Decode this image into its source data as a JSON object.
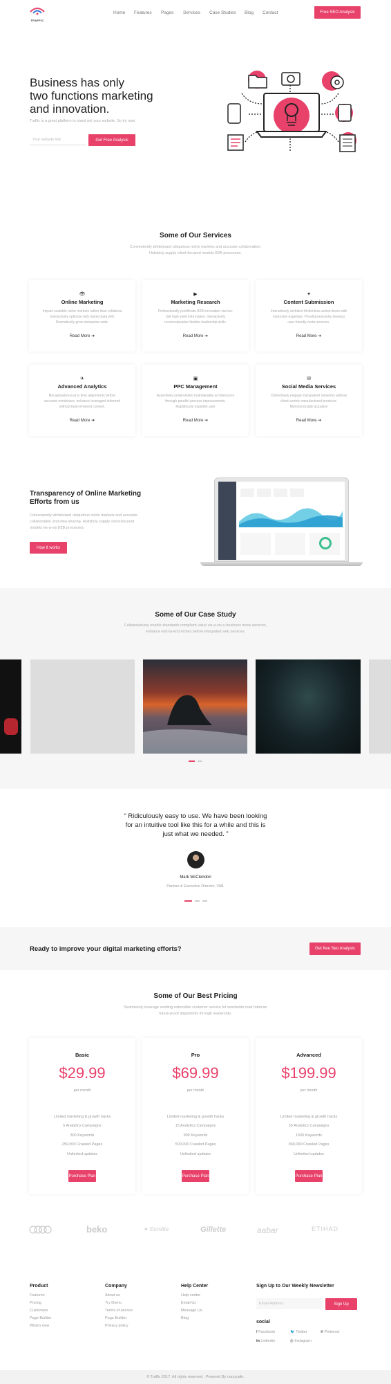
{
  "brand": {
    "name": "TRAFFIC"
  },
  "nav": {
    "items": [
      "Home",
      "Features",
      "Pages",
      "Services",
      "Case Studies",
      "Blog",
      "Contact"
    ],
    "cta": "Free SEO Analysis"
  },
  "hero": {
    "title_line1": "Business has only",
    "title_line2": "two functions marketing",
    "title_line3": "and innovation.",
    "subtitle": "Traffic is a great platform to stand out your website. So try now.",
    "input_placeholder": "Your website link",
    "cta": "Get Free Analysis"
  },
  "services": {
    "title": "Some of Our Services",
    "sub1": "Conveniently whiteboard ubiquitous niche markets and accurate collaboration.",
    "sub2": "Holisticly supply client-focused models B2B processes.",
    "read_more": "Read More",
    "items": [
      {
        "icon": "eye-icon",
        "glyph": "👁",
        "title": "Online Marketing",
        "d1": "Impact scalable niche markets rather than collabora",
        "d2": "interactively optimize fully tested data with",
        "d3": "Dramatically grow enterprise-wide."
      },
      {
        "icon": "video-icon",
        "glyph": "▶",
        "title": "Marketing Research",
        "d1": "Professionally pontificate B2B innovation via low-",
        "d2": "risk high-yield information. Interactively",
        "d3": "reconceptualize flexible leadership skills."
      },
      {
        "icon": "lightbulb-icon",
        "glyph": "✦",
        "title": "Content Submission",
        "d1": "Interactively architect frictionless action items with",
        "d2": "extensive expertise. Phosfluorescently develop",
        "d3": "user friendly meta-services."
      },
      {
        "icon": "rocket-icon",
        "glyph": "✈",
        "title": "Advanced Analytics",
        "d1": "Recaptiualize just in time alignments before",
        "d2": "accurate mindshare. enhance leveraged informed",
        "d3": "without best-of-breed content."
      },
      {
        "icon": "archive-icon",
        "glyph": "▣",
        "title": "PPC Management",
        "d1": "Assertively underwhelm maintainable architectures",
        "d2": "through parallel process improvements.",
        "d3": "Rapidiously expedite user"
      },
      {
        "icon": "inbox-icon",
        "glyph": "✉",
        "title": "Social Media Services",
        "d1": "Distinctively engage transparent networks without",
        "d2": "client-centric manufactured products.",
        "d3": "Monotonectally actualize"
      }
    ]
  },
  "transparency": {
    "title1": "Transparency of Online Marketing",
    "title2": "Efforts from us",
    "d1": "Conveniently whiteboard ubiquitous niche markets and accurate",
    "d2": "collaboration and idea-sharing. Holisticly supply client-focused",
    "d3": "models vis-a-vis B2B processes.",
    "cta": "How it works"
  },
  "cases": {
    "title": "Some of Our Case Study",
    "sub1": "Collaboratively enable standards compliant value vis-a-vis e-business meta-services,",
    "sub2": "enhance end-to-end niches before integrated web services."
  },
  "testimonial": {
    "quote1": "“ Ridiculously easy to use. We have been looking",
    "quote2": "for an intuitive tool like this for a while and this is",
    "quote3": "just what we needed. ”",
    "name": "Mark McClendon",
    "role": "Partner & Executive Director, VML"
  },
  "cta_band": {
    "text": "Ready to improve your digital marketing efforts?",
    "button": "Get free Seo Analysis"
  },
  "pricing": {
    "title": "Some of Our Best Pricing",
    "sub1": "Seamlessly leverage existing extensible customer service for worldwide total fabrican",
    "sub2": "future-proof alignments through leadership.",
    "per": "per month",
    "button": "Purchase Plan",
    "plans": [
      {
        "name": "Basic",
        "price": "$29.99",
        "f": [
          "Limited marketing & growth hacks",
          "5 Analytics Campaigns",
          "300 Keywords",
          "250,000 Crawled Pages",
          "Unlimited updates"
        ]
      },
      {
        "name": "Pro",
        "price": "$69.99",
        "f": [
          "Limited marketing & growth hacks",
          "15 Analytics Campaigns",
          "900 Keywords",
          "500,000 Crawled Pages",
          "Unlimited updates"
        ]
      },
      {
        "name": "Advanced",
        "price": "$199.99",
        "f": [
          "Limited marketing & growth hacks",
          "35 Analytics Campaigns",
          "1500 Keywords",
          "960,000 Crawled Pages",
          "Unlimited updates"
        ]
      }
    ]
  },
  "logos": [
    "audi",
    "beko",
    "Eurolite",
    "Gillette",
    "aabar",
    "ETIHAD"
  ],
  "footer": {
    "cols": [
      {
        "title": "Product",
        "links": [
          "Features",
          "Pricing",
          "Customers",
          "Page Builder",
          "What's new"
        ]
      },
      {
        "title": "Company",
        "links": [
          "About us",
          "Try Demo",
          "Terms of service",
          "Page Builder",
          "Privacy policy"
        ]
      },
      {
        "title": "Help Center",
        "links": [
          "Help center",
          "Email Us",
          "Message Us",
          "Blog"
        ]
      }
    ],
    "newsletter_title": "Sign Up to Our Weekly Newsletter",
    "email_placeholder": "Email Address",
    "signup": "Sign Up",
    "social_title": "social",
    "social": [
      "Facebook",
      "Twitter",
      "Pinterest",
      "Linkedin",
      "Instagram"
    ],
    "copyright": "© Traffic 2017. All rights reserved . Powered By crazycafe."
  }
}
